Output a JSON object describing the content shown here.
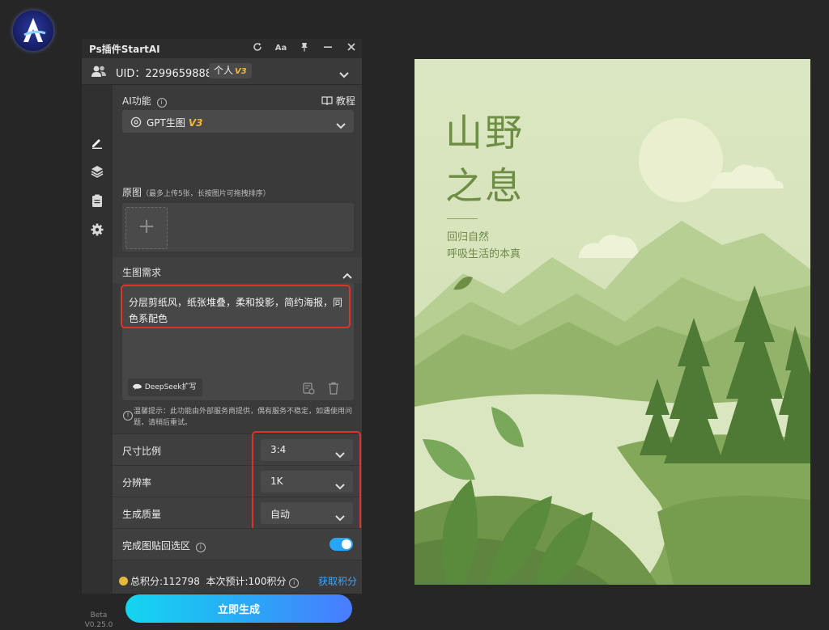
{
  "panel": {
    "title": "Ps插件StartAI",
    "uid": "UID：2299659888",
    "tier": "个人",
    "tier_version": "V3",
    "version_label": "Beta",
    "version_number": "V0.25.0"
  },
  "ai": {
    "label": "AI功能",
    "tutorial": "教程",
    "feature": "GPT生图",
    "feature_version": "V3"
  },
  "source": {
    "label": "原图",
    "hint": "（最多上传5张，长按图片可拖拽排序）"
  },
  "prompt": {
    "section_title": "生图需求",
    "text": "分层剪纸风，纸张堆叠，柔和投影，简约海报，同色系配色",
    "deepseek_label": "DeepSeek扩写",
    "notice": "温馨提示：此功能由外部服务商提供，偶有服务不稳定，如遇使用问题，请稍后重试。"
  },
  "options": [
    {
      "label": "尺寸比例",
      "value": "3:4"
    },
    {
      "label": "分辨率",
      "value": "1K"
    },
    {
      "label": "生成质量",
      "value": "自动"
    }
  ],
  "paste_back": {
    "label": "完成图贴回选区",
    "enabled": true
  },
  "footer": {
    "total_points": "总积分:112798",
    "estimate": "本次预计:100积分",
    "get_points": "获取积分",
    "generate": "立即生成"
  },
  "poster": {
    "title_line1": "山野",
    "title_line2": "之息",
    "sub_line1": "回归自然",
    "sub_line2": "呼吸生活的本真"
  },
  "colors": {
    "accent": "#2aa4f4",
    "highlight_border": "#e0322a",
    "coin": "#e8b83a",
    "version_tag": "#f2b53a"
  },
  "icons": {
    "title_actions": [
      "refresh-icon",
      "font-size-icon",
      "pin-icon",
      "minimize-icon",
      "close-icon"
    ],
    "sidebar": [
      "edit-icon",
      "layers-icon",
      "clipboard-icon",
      "gear-icon"
    ]
  }
}
